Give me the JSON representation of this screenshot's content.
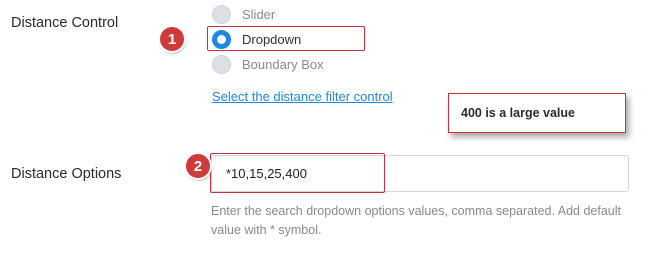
{
  "distance_control": {
    "label": "Distance Control",
    "options": [
      "Slider",
      "Dropdown",
      "Boundary Box"
    ],
    "selected": "Dropdown",
    "link_text": "Select the distance filter control"
  },
  "callouts": {
    "step1": "1",
    "step2": "2",
    "tooltip": "400 is a large value"
  },
  "distance_options": {
    "label": "Distance Options",
    "value": "*10,15,25,400",
    "help": "Enter the search dropdown options values, comma separated. Add default value with * symbol."
  },
  "colors": {
    "accent": "#1e88e5",
    "annotation_red": "#c8313d"
  }
}
